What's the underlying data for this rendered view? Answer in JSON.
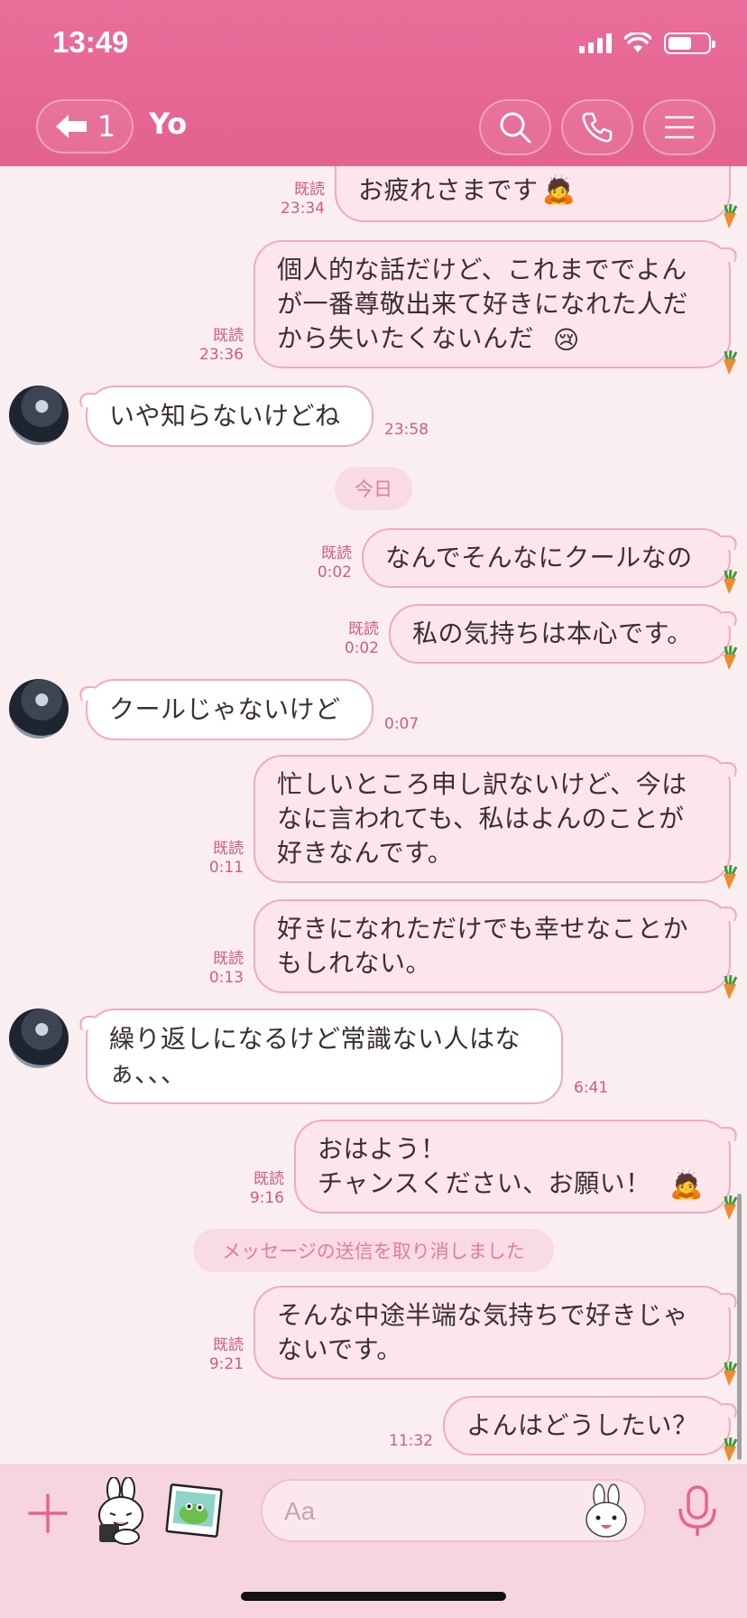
{
  "status": {
    "time": "13:49"
  },
  "header": {
    "back_count": "1",
    "title": "Yo"
  },
  "messages": [
    {
      "id": "m1",
      "sender": "me",
      "text": "お疲れさまです",
      "read": "既読",
      "time": "23:34"
    },
    {
      "id": "m2",
      "sender": "me",
      "text": "個人的な話だけど、これまででよん\nが一番尊敬出来て好きになれた人だ\nから失いたくないんだ",
      "read": "既読",
      "time": "23:36"
    },
    {
      "id": "m3",
      "sender": "them",
      "text": "いや知らないけどね",
      "time": "23:58"
    },
    {
      "id": "m4",
      "sender": "me",
      "text": "なんでそんなにクールなの",
      "read": "既読",
      "time": "0:02"
    },
    {
      "id": "m5",
      "sender": "me",
      "text": "私の気持ちは本心です。",
      "read": "既読",
      "time": "0:02"
    },
    {
      "id": "m6",
      "sender": "them",
      "text": "クールじゃないけど",
      "time": "0:07"
    },
    {
      "id": "m7",
      "sender": "me",
      "text": "忙しいところ申し訳ないけど、今は\nなに言われても、私はよんのことが\n好きなんです。",
      "read": "既読",
      "time": "0:11"
    },
    {
      "id": "m8",
      "sender": "me",
      "text": "好きになれただけでも幸せなことか\nもしれない。",
      "read": "既読",
      "time": "0:13"
    },
    {
      "id": "m9",
      "sender": "them",
      "text": "繰り返しになるけど常識ない人はな\nぁ、、、",
      "time": "6:41"
    },
    {
      "id": "m10",
      "sender": "me",
      "text": "おはよう！\nチャンスください、お願い！",
      "read": "既読",
      "time": "9:16"
    },
    {
      "id": "m11",
      "sender": "me",
      "text": "そんな中途半端な気持ちで好きじゃ\nないです。",
      "read": "既読",
      "time": "9:21"
    },
    {
      "id": "m12",
      "sender": "me",
      "text": "よんはどうしたい？",
      "time": "11:32"
    }
  ],
  "date_divider": "今日",
  "system_notice": "メッセージの送信を取り消しました",
  "composer": {
    "placeholder": "Aa"
  },
  "icons": {
    "back": "arrow-left-icon",
    "search": "search-icon",
    "call": "phone-icon",
    "menu": "hamburger-icon",
    "plus": "plus-icon",
    "sticker": "bunny-sticker-icon",
    "photo": "photo-icon",
    "emoji": "bunny-face-icon",
    "mic": "microphone-icon"
  },
  "colors": {
    "header": "#e5648f",
    "accent": "#d05b86",
    "bubble_mine": "#fce6ec",
    "bubble_theirs": "#ffffff",
    "background": "#fbeef1"
  }
}
